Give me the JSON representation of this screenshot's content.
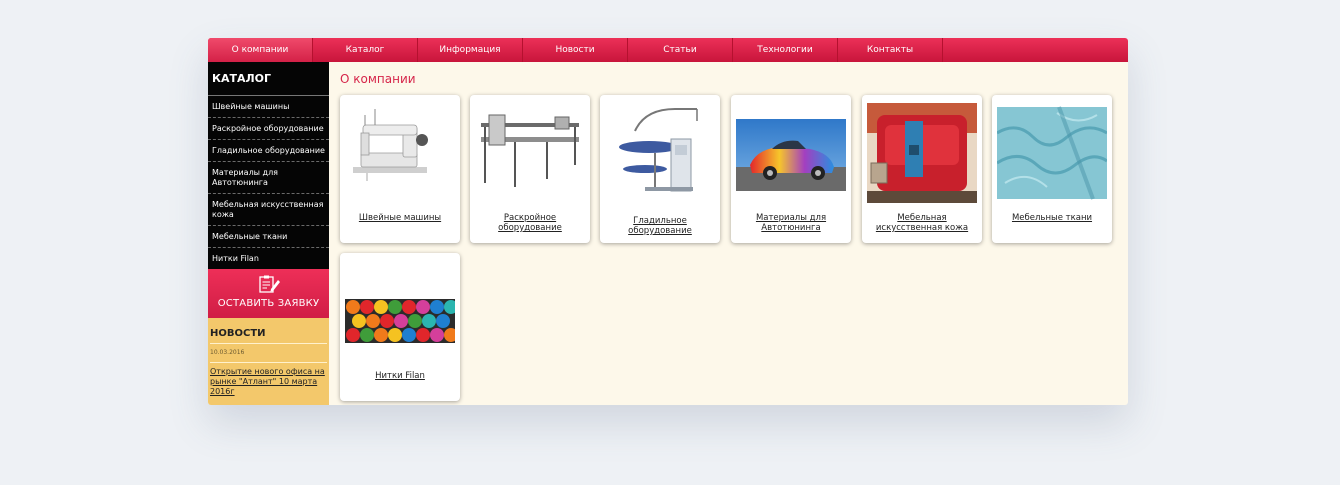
{
  "nav": {
    "items": [
      "О компании",
      "Каталог",
      "Информация",
      "Новости",
      "Статьи",
      "Технологии",
      "Контакты"
    ],
    "active": 0
  },
  "sidebar": {
    "catalog_title": "КАТАЛОГ",
    "items": [
      "Швейные машины",
      "Раскройное оборудование",
      "Гладильное оборудование",
      "Материалы для Автотюнинга",
      "Мебельная искусственная кожа",
      "Мебельные ткани",
      "Нитки Filan"
    ],
    "order_button": "ОСТАВИТЬ ЗАЯВКУ",
    "news": {
      "title": "НОВОСТИ",
      "date": "10.03.2016",
      "link": "Открытие нового офиса на рынке \"Атлант\" 10 марта 2016г"
    }
  },
  "main": {
    "title": "О компании",
    "cards": [
      "Швейные машины",
      "Раскройное оборудование",
      "Гладильное оборудование",
      "Материалы для Автотюнинга",
      "Мебельная искусственная кожа",
      "Мебельные ткани",
      "Нитки Filan"
    ]
  },
  "colors": {
    "accent": "#d6254a",
    "nav": "#e02a50",
    "news_bg": "#f3c86b",
    "content_bg": "#fdf8ea"
  }
}
